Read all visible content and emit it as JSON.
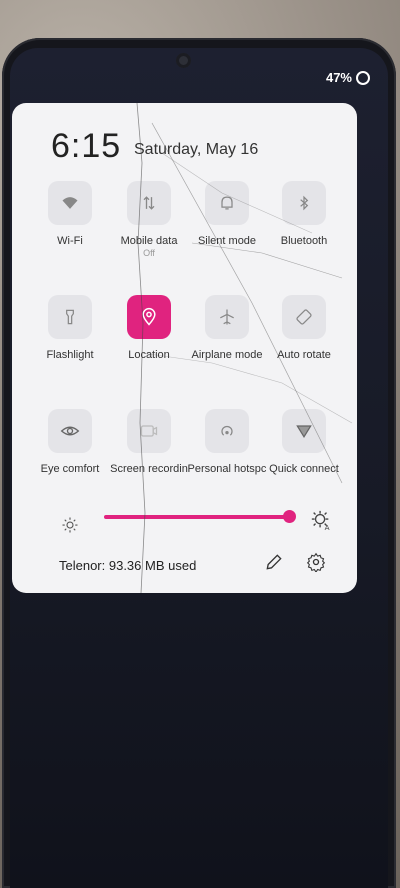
{
  "status": {
    "battery": "47%"
  },
  "clock": {
    "time": "6:15",
    "date": "Saturday, May 16"
  },
  "tiles": [
    {
      "label": "Wi-Fi",
      "icon": "wifi-icon",
      "active": false
    },
    {
      "label": "Mobile data",
      "sub": "Off",
      "icon": "mobile-data-icon",
      "active": false
    },
    {
      "label": "Silent mode",
      "icon": "bell-icon",
      "active": false
    },
    {
      "label": "Bluetooth",
      "icon": "bluetooth-icon",
      "active": false
    },
    {
      "label": "Flashlight",
      "icon": "flashlight-icon",
      "active": false
    },
    {
      "label": "Location",
      "icon": "location-pin-icon",
      "active": true
    },
    {
      "label": "Airplane mode",
      "icon": "airplane-icon",
      "active": false
    },
    {
      "label": "Auto rotate",
      "icon": "rotate-icon",
      "active": false
    },
    {
      "label": "Eye comfort",
      "icon": "eye-icon",
      "active": false
    },
    {
      "label": "Screen recordin",
      "icon": "screen-record-icon",
      "active": false
    },
    {
      "label": "Personal hotspc",
      "icon": "hotspot-icon",
      "active": false
    },
    {
      "label": "Quick connect",
      "icon": "quick-connect-icon",
      "active": false
    }
  ],
  "brightness": {
    "level": 0.95
  },
  "footer": {
    "data_usage": "Telenor: 93.36 MB used"
  },
  "colors": {
    "accent": "#e0237f",
    "panel": "#f3f3f5"
  }
}
